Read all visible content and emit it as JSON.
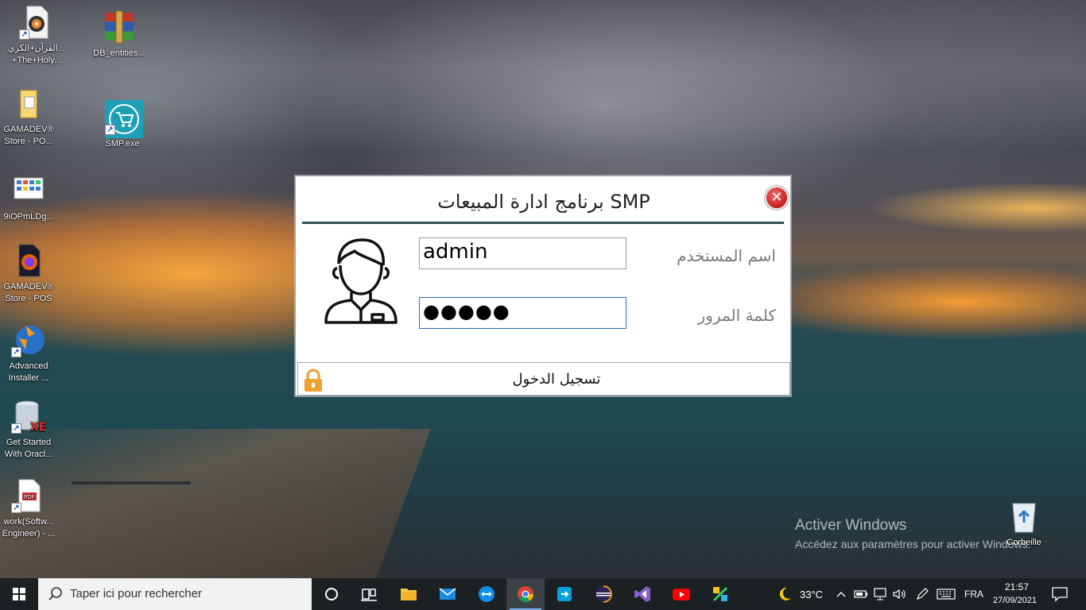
{
  "desktop": {
    "icons": [
      {
        "label": "القرآن+الكري...\n+The+Holy..."
      },
      {
        "label": "DB_entities..."
      },
      {
        "label": "GAMADEV®\nStore - PO..."
      },
      {
        "label": "SMP.exe"
      },
      {
        "label": "9iOPmLDg..."
      },
      {
        "label": "GAMADEV®\nStore - POS"
      },
      {
        "label": "Advanced\nInstaller ..."
      },
      {
        "label": "Get Started\nWith Oracl..."
      },
      {
        "label": "work(Softw...\nEngineer) - ..."
      },
      {
        "label": "Corbeille"
      }
    ]
  },
  "dialog": {
    "title": "برنامج ادارة المبيعات SMP",
    "username_label": "اسم المستخدم",
    "username_value": "admin",
    "password_label": "كلمة المرور",
    "password_mask": "●●●●●",
    "login_label": "تسجيل الدخول",
    "close_symbol": "✕",
    "colors": {
      "underline": "#2f5258",
      "close": "#d32f2f",
      "lock": "#f0a030"
    }
  },
  "watermark": {
    "title": "Activer Windows",
    "subtitle": "Accédez aux paramètres pour activer Windows."
  },
  "taskbar": {
    "search_placeholder": "Taper ici pour rechercher",
    "weather_temp": "33°C",
    "language": "FRA",
    "time": "21:57",
    "date": "27/09/2021",
    "apps": [
      "file-explorer",
      "mail",
      "teamviewer",
      "chrome",
      "remote-desktop",
      "eclipse",
      "visual-studio",
      "youtube",
      "tool"
    ]
  }
}
